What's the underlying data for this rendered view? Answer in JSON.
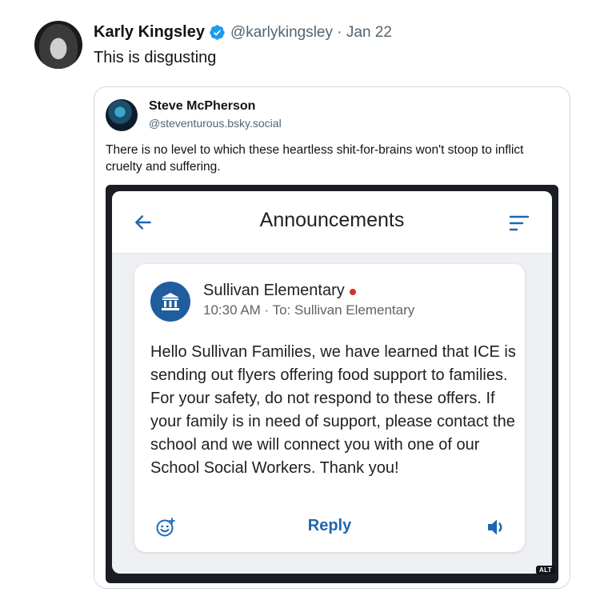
{
  "tweet": {
    "author_name": "Karly Kingsley",
    "author_handle": "@karlykingsley",
    "separator": "·",
    "date": "Jan 22",
    "text": "This is disgusting",
    "verified_icon": "verified-badge-icon",
    "verified_color": "#1d9bf0"
  },
  "quote": {
    "author_name": "Steve McPherson",
    "author_handle": "@steventurous.bsky.social",
    "text": "There is no level to which these heartless shit-for-brains won't stoop to inflict cruelty and suffering.",
    "alt_badge": "ALT"
  },
  "screenshot": {
    "appbar": {
      "title": "Announcements",
      "back_icon": "arrow-left-icon",
      "filter_icon": "filter-lines-icon"
    },
    "card": {
      "sender": "Sullivan Elementary",
      "meta": "10:30 AM · To: Sullivan Elementary",
      "logo_icon": "bank-building-icon",
      "unread_color": "#d93025",
      "message": "Hello Sullivan Families, we have learned that ICE is sending out flyers offering food support to families.  For your safety, do not respond to these offers. If your family is in need of support, please contact the school and we will connect you with one of our School Social Workers. Thank you!",
      "reply_label": "Reply",
      "emoji_icon": "add-reaction-icon",
      "speaker_icon": "speaker-icon",
      "accent_color": "#1f66b3"
    }
  }
}
